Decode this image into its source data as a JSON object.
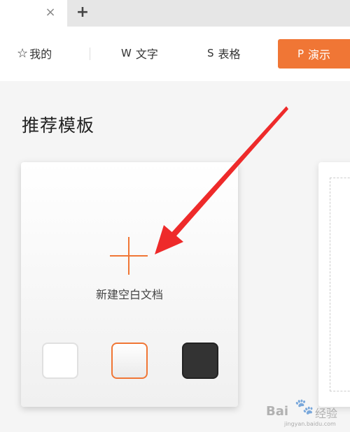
{
  "tabs": {
    "close_icon": "×",
    "add_icon": "+"
  },
  "toolbar": {
    "mine": {
      "icon": "☆",
      "label": "我的"
    },
    "writer": {
      "icon": "W",
      "label": "文字"
    },
    "sheet": {
      "icon": "S",
      "label": "表格"
    },
    "presentation": {
      "icon": "P",
      "label": "演示"
    },
    "accent_color": "#f07635"
  },
  "section": {
    "title": "推荐模板"
  },
  "card": {
    "label": "新建空白文档",
    "swatches": [
      "white",
      "light-gray",
      "dark"
    ]
  },
  "watermark": {
    "brand_left": "Bai",
    "brand_right": "经验",
    "url": "jingyan.baidu.com"
  },
  "annotation": {
    "arrow_color": "#ee2a2a"
  }
}
